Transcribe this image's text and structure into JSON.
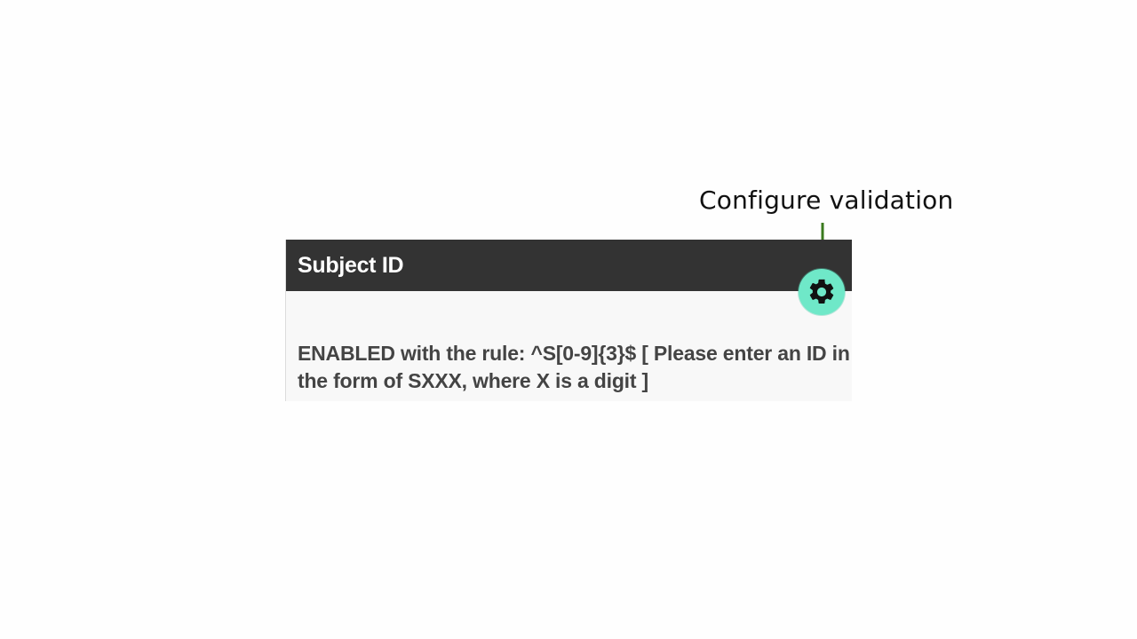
{
  "annotation": {
    "label": "Configure validation",
    "arrow_color": "#3b7a1e"
  },
  "panel": {
    "title": "Subject ID",
    "validation_text": "ENABLED with the rule: ^S[0-9]{3}$ [ Please enter an ID in the form of SXXX, where X is a digit ]",
    "header_color": "#333333"
  },
  "gear_button": {
    "icon": "gear-icon",
    "background": "#6fe8c8"
  }
}
